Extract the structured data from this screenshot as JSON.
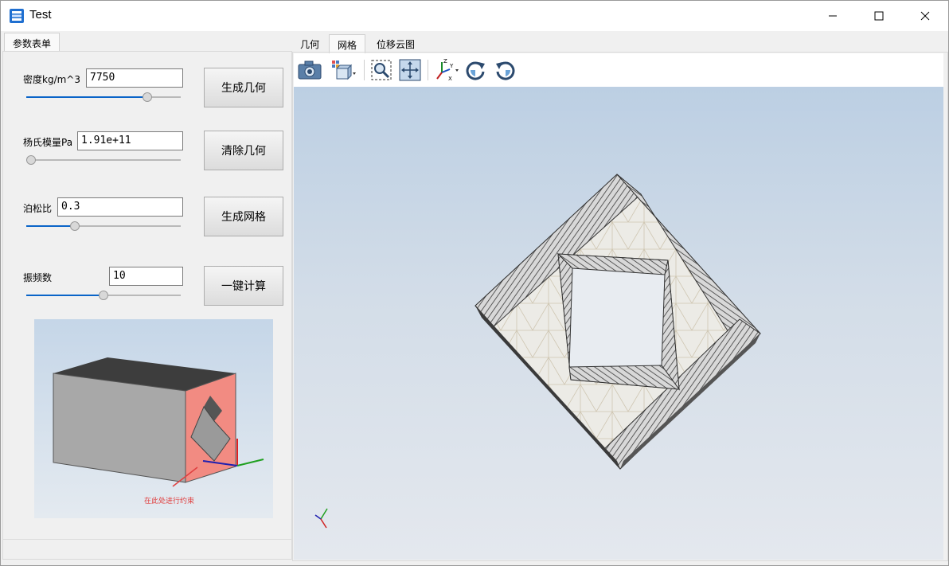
{
  "window": {
    "title": "Test",
    "app_icon": "app-logo-icon",
    "controls": [
      "minimize-icon",
      "maximize-icon",
      "close-icon"
    ]
  },
  "left_panel": {
    "tab_label": "参数表单",
    "params": [
      {
        "label": "密度kg/m^3",
        "value": "7750",
        "slider_fraction": 0.8
      },
      {
        "label": "杨氏模量Pa",
        "value": "1.91e+11",
        "slider_fraction": 0.0
      },
      {
        "label": "泊松比",
        "value": "0.3",
        "slider_fraction": 0.3
      },
      {
        "label": "振频数",
        "value": "10",
        "slider_fraction": 0.5
      }
    ],
    "buttons": [
      "生成几何",
      "清除几何",
      "生成网格",
      "一键计算"
    ],
    "preview": {
      "annotation": "在此处进行约束",
      "face_color": "#f28b82",
      "box_top_color": "#3d3d3d",
      "box_side_color": "#a8a8a8"
    }
  },
  "right_panel": {
    "tabs": [
      {
        "label": "几何",
        "active": false
      },
      {
        "label": "网格",
        "active": true
      },
      {
        "label": "位移云图",
        "active": false
      }
    ],
    "toolbar": [
      "camera-icon",
      "view-cube-icon",
      "zoom-window-icon",
      "fit-all-icon",
      "axes-icon",
      "rotate-cw-icon",
      "rotate-ccw-icon"
    ],
    "viewport": {
      "background_top": "#bccfe3",
      "background_bottom": "#e4e8ee",
      "mesh_color": "#e0d8c8",
      "outline_color": "#3a3a3a"
    }
  }
}
